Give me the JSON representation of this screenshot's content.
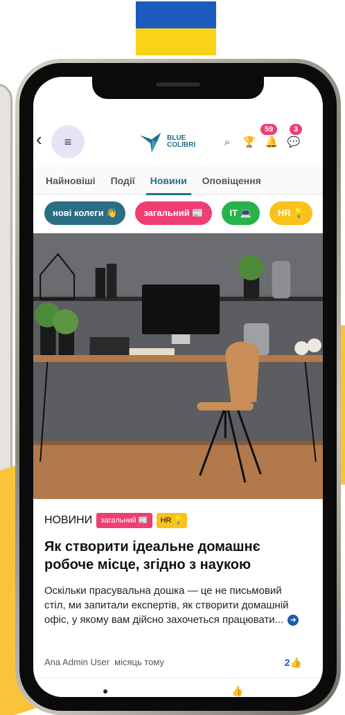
{
  "header": {
    "back_label": "‹",
    "menu_label": "≡",
    "logo_line1": "BLUE",
    "logo_line2": "COLIBRI",
    "search_icon": "⌕",
    "trophy_icon": "🏆",
    "bell_icon": "🔔",
    "chat_icon": "💬",
    "notifications_count": "59",
    "messages_count": "3"
  },
  "tabs": [
    {
      "label": "Найновіші",
      "active": false
    },
    {
      "label": "Події",
      "active": false
    },
    {
      "label": "Новини",
      "active": true
    },
    {
      "label": "Оповіщення",
      "active": false
    }
  ],
  "chips": [
    {
      "label": "нові колеги 👋",
      "color": "#2a6d84"
    },
    {
      "label": "загальний 📰",
      "color": "#ef3e73"
    },
    {
      "label": "IT 💻",
      "color": "#27b34a"
    },
    {
      "label": "HR 💡",
      "color": "#f9c21b"
    }
  ],
  "article": {
    "category": "НОВИНИ",
    "tags": [
      {
        "label": "загальний 📰",
        "color": "#ef3e73"
      },
      {
        "label": "HR 💡",
        "color": "#f9c21b"
      }
    ],
    "title": "Як створити ідеальне домашнє робоче місце, згідно з наукою",
    "excerpt": "Оскільки прасувальна дошка — це не письмовий стіл, ми запитали експертів, як створити домашній офіс, у якому вам дійсно захочеться працювати...",
    "author": "Ana Admin User",
    "time": "місяць тому",
    "likes": "2",
    "like_icon": "👍"
  },
  "footer": {
    "comment_icon": "●",
    "like_icon": "👍"
  },
  "colors": {
    "accent": "#2a6d84",
    "pink": "#ef3e73",
    "green": "#27b34a",
    "yellow": "#f9c21b",
    "flag_blue": "#1d5bbf",
    "flag_yellow": "#f9d21a"
  }
}
